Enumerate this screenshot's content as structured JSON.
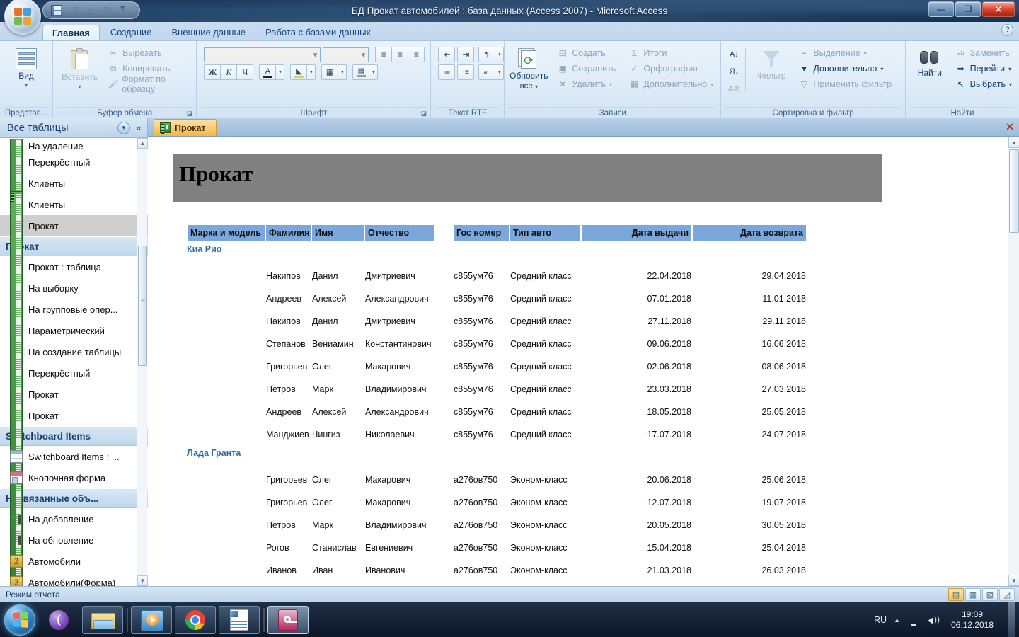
{
  "window": {
    "title": "БД Прокат автомобилей : база данных (Access 2007) - Microsoft Access",
    "minimize": "—",
    "maximize": "❐",
    "close": "✕"
  },
  "quick_access": {
    "save": "save-icon",
    "undo": "↺",
    "undo_arrow": "▾",
    "redo": "↻",
    "redo_arrow": "▾",
    "customize": "▾"
  },
  "ribbon": {
    "help": "?",
    "tabs": [
      {
        "label": "Главная",
        "active": true
      },
      {
        "label": "Создание",
        "active": false
      },
      {
        "label": "Внешние данные",
        "active": false
      },
      {
        "label": "Работа с базами данных",
        "active": false
      }
    ],
    "groups": [
      {
        "name": "Представ...",
        "big": {
          "label": "Вид",
          "arrow": "▾"
        }
      },
      {
        "name": "Буфер обмена",
        "paste": {
          "label": "Вставить",
          "arrow": "▾"
        },
        "commands": [
          {
            "label": "Вырезать",
            "icon": "scissors-icon"
          },
          {
            "label": "Копировать",
            "icon": "copy-icon"
          },
          {
            "label": "Формат по образцу",
            "icon": "format-painter-icon"
          }
        ],
        "dialog": "◪"
      },
      {
        "name": "Шрифт",
        "font_name": "",
        "font_size": "",
        "align": [
          "align-left-icon",
          "align-center-icon",
          "align-right-icon"
        ],
        "bold": "Ж",
        "italic": "К",
        "underline": "Ч",
        "font_color": "A",
        "fill_color": "fill-icon",
        "gridlines": "grid-icon",
        "alt_fill": "alt-row-icon",
        "dialog": "◪"
      },
      {
        "name": "Текст RTF",
        "buttons": [
          "decrease-indent-icon",
          "increase-indent-icon",
          "ltr-icon",
          "numbered-list-icon",
          "bullet-list-icon",
          "highlight-icon"
        ]
      },
      {
        "name": "Записи",
        "refresh": {
          "label_top": "Обновить",
          "label_bottom": "все",
          "arrow": "▾"
        },
        "commands": [
          {
            "label": "Создать",
            "icon": "new-record-icon"
          },
          {
            "label": "Сохранить",
            "icon": "save-record-icon"
          },
          {
            "label": "Удалить",
            "icon": "delete-icon",
            "arrow": "▾"
          },
          {
            "label": "Итоги",
            "icon": "sigma-icon"
          },
          {
            "label": "Орфография",
            "icon": "spelling-icon"
          },
          {
            "label": "Дополнительно",
            "icon": "more-icon",
            "arrow": "▾"
          }
        ]
      },
      {
        "name": "Сортировка и фильтр",
        "sort_asc": "sort-ascending-icon",
        "sort_desc": "sort-descending-icon",
        "sort_clear": "clear-sort-icon",
        "filter": {
          "label": "Фильтр"
        },
        "commands": [
          {
            "label": "Выделение",
            "icon": "selection-icon",
            "arrow": "▾"
          },
          {
            "label": "Дополнительно",
            "icon": "advanced-filter-icon",
            "arrow": "▾"
          },
          {
            "label": "Применить фильтр",
            "icon": "toggle-filter-icon"
          }
        ]
      },
      {
        "name": "Найти",
        "find": {
          "label": "Найти"
        },
        "commands": [
          {
            "label": "Заменить",
            "icon": "replace-icon"
          },
          {
            "label": "Перейти",
            "icon": "goto-icon",
            "arrow": "▾"
          },
          {
            "label": "Выбрать",
            "icon": "select-icon",
            "arrow": "▾"
          }
        ]
      }
    ]
  },
  "navpane": {
    "title": "Все таблицы",
    "dropdown": "▾",
    "collapse": "«",
    "scroll_up": "▲",
    "scroll_down": "▼",
    "items": [
      {
        "label": "На удаление",
        "icon": "query-delete-icon",
        "type": "qdel",
        "partial": true,
        "selected": false
      },
      {
        "label": "Перекрёстный",
        "icon": "crosstab-query-icon",
        "type": "cross",
        "selected": false
      },
      {
        "label": "Клиенты",
        "icon": "form-icon",
        "type": "form",
        "selected": false
      },
      {
        "label": "Клиенты",
        "icon": "report-icon",
        "type": "report",
        "selected": false
      },
      {
        "label": "Прокат",
        "icon": "report-icon",
        "type": "report",
        "selected": true
      },
      {
        "group": "Прокат",
        "chevron": "⌃"
      },
      {
        "label": "Прокат : таблица",
        "icon": "table-icon",
        "type": "table",
        "selected": false
      },
      {
        "label": "На выборку",
        "icon": "query-icon",
        "type": "query",
        "selected": false
      },
      {
        "label": "На групповые опер...",
        "icon": "query-icon",
        "type": "query",
        "selected": false
      },
      {
        "label": "Параметрический",
        "icon": "query-icon",
        "type": "query",
        "selected": false
      },
      {
        "label": "На создание таблицы",
        "icon": "make-table-query-icon",
        "type": "qmake",
        "selected": false
      },
      {
        "label": "Перекрёстный",
        "icon": "crosstab-query-icon",
        "type": "cross",
        "selected": false
      },
      {
        "label": "Прокат",
        "icon": "form-icon",
        "type": "form",
        "selected": false
      },
      {
        "label": "Прокат",
        "icon": "report-icon",
        "type": "report",
        "selected": false
      },
      {
        "group": "Switchboard Items",
        "chevron": "⌃"
      },
      {
        "label": "Switchboard Items : ...",
        "icon": "table-icon",
        "type": "table",
        "selected": false
      },
      {
        "label": "Кнопочная форма",
        "icon": "form-icon",
        "type": "form",
        "selected": false
      },
      {
        "group": "Несвязанные объ...",
        "chevron": "⌃"
      },
      {
        "label": "На добавление",
        "icon": "append-query-icon",
        "type": "qadd",
        "selected": false
      },
      {
        "label": "На обновление",
        "icon": "update-query-icon",
        "type": "qupd",
        "selected": false
      },
      {
        "label": "Автомобили",
        "icon": "module-icon",
        "type": "module",
        "selected": false
      },
      {
        "label": "Автомобили(Форма)",
        "icon": "module-icon",
        "type": "module",
        "selected": false
      }
    ]
  },
  "document": {
    "tab_label": "Прокат",
    "tab_icon": "report-icon",
    "close": "✕",
    "report_title": "Прокат",
    "scroll_up": "▲",
    "scroll_down": "▼",
    "columns": [
      {
        "label": "Марка и модель",
        "align": "left"
      },
      {
        "label": "Фамилия",
        "align": "left"
      },
      {
        "label": "Имя",
        "align": "left"
      },
      {
        "label": "Отчество",
        "align": "left"
      },
      {
        "label": "Гос номер",
        "align": "left"
      },
      {
        "label": "Тип авто",
        "align": "left"
      },
      {
        "label": "Дата выдачи",
        "align": "right"
      },
      {
        "label": "Дата возврата",
        "align": "right"
      }
    ],
    "groups": [
      {
        "name": "Киа Рио",
        "rows": [
          [
            "",
            "Накипов",
            "Данил",
            "Дмитриевич",
            "с855ум76",
            "Средний класс",
            "22.04.2018",
            "29.04.2018"
          ],
          [
            "",
            "Андреев",
            "Алексей",
            "Александрович",
            "с855ум76",
            "Средний класс",
            "07.01.2018",
            "11.01.2018"
          ],
          [
            "",
            "Накипов",
            "Данил",
            "Дмитриевич",
            "с855ум76",
            "Средний класс",
            "27.11.2018",
            "29.11.2018"
          ],
          [
            "",
            "Степанов",
            "Вениамин",
            "Константинович",
            "с855ум76",
            "Средний класс",
            "09.06.2018",
            "16.06.2018"
          ],
          [
            "",
            "Григорьев",
            "Олег",
            "Макарович",
            "с855ум76",
            "Средний класс",
            "02.06.2018",
            "08.06.2018"
          ],
          [
            "",
            "Петров",
            "Марк",
            "Владимирович",
            "с855ум76",
            "Средний класс",
            "23.03.2018",
            "27.03.2018"
          ],
          [
            "",
            "Андреев",
            "Алексей",
            "Александрович",
            "с855ум76",
            "Средний класс",
            "18.05.2018",
            "25.05.2018"
          ],
          [
            "",
            "Манджиев",
            "Чингиз",
            "Николаевич",
            "с855ум76",
            "Средний класс",
            "17.07.2018",
            "24.07.2018"
          ]
        ]
      },
      {
        "name": "Лада Гранта",
        "rows": [
          [
            "",
            "Григорьев",
            "Олег",
            "Макарович",
            "а276ов750",
            "Эконом-класс",
            "20.06.2018",
            "25.06.2018"
          ],
          [
            "",
            "Григорьев",
            "Олег",
            "Макарович",
            "а276ов750",
            "Эконом-класс",
            "12.07.2018",
            "19.07.2018"
          ],
          [
            "",
            "Петров",
            "Марк",
            "Владимирович",
            "а276ов750",
            "Эконом-класс",
            "20.05.2018",
            "30.05.2018"
          ],
          [
            "",
            "Рогов",
            "Станислав",
            "Евгениевич",
            "а276ов750",
            "Эконом-класс",
            "15.04.2018",
            "25.04.2018"
          ],
          [
            "",
            "Иванов",
            "Иван",
            "Иванович",
            "а276ов750",
            "Эконом-класс",
            "21.03.2018",
            "26.03.2018"
          ]
        ]
      }
    ]
  },
  "statusbar": {
    "mode": "Режим отчета",
    "views": [
      {
        "name": "report-view",
        "glyph": "▤",
        "active": true
      },
      {
        "name": "print-preview",
        "glyph": "▥",
        "active": false
      },
      {
        "name": "layout-view",
        "glyph": "▧",
        "active": false
      },
      {
        "name": "design-view",
        "glyph": "◿",
        "active": false
      }
    ]
  },
  "taskbar": {
    "start": "start-orb",
    "items": [
      {
        "name": "bittorrent",
        "framed": false
      },
      {
        "name": "file-explorer",
        "framed": true
      },
      {
        "name": "windows-media-player",
        "framed": true
      },
      {
        "name": "google-chrome",
        "framed": true
      },
      {
        "name": "word-document",
        "framed": true
      },
      {
        "name": "microsoft-access",
        "framed": true,
        "active": true
      }
    ],
    "tray": {
      "language": "RU",
      "show_hidden": "▲",
      "network": "network-icon",
      "volume": "volume-icon",
      "time": "19:09",
      "date": "06.12.2018"
    }
  },
  "colors": {
    "header_blue": "#7ba7dd",
    "banner_gray": "#808080",
    "group_label": "#2e6aa8",
    "tab_orange": "#f6b543"
  }
}
